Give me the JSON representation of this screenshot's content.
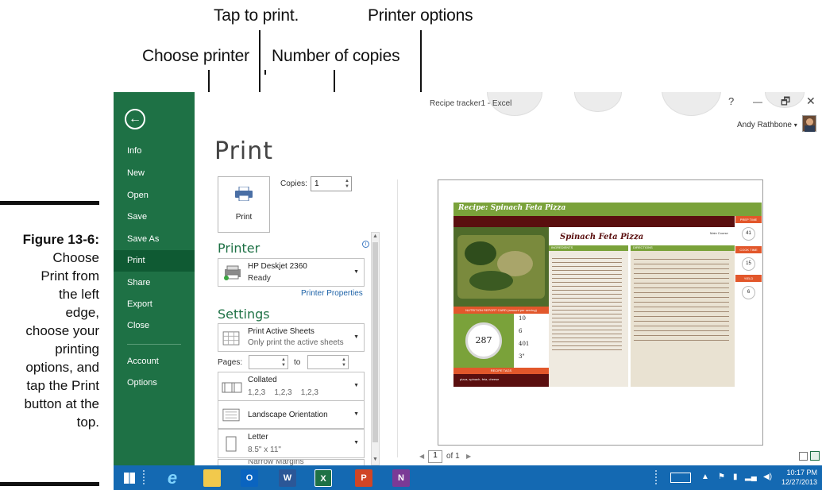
{
  "callouts": {
    "tap_to_print": "Tap to print.",
    "printer_options": "Printer options",
    "choose_printer": "Choose printer",
    "number_of_copies": "Number of copies"
  },
  "caption": {
    "figure": "Figure 13-6:",
    "lines": [
      "Choose",
      "Print from",
      "the left",
      "edge,",
      "choose your",
      "printing",
      "options, and",
      "tap the Print",
      "button at the",
      "top."
    ]
  },
  "app": {
    "window_title": "Recipe tracker1 - Excel",
    "help": "?",
    "minimize": "—",
    "restore": "🗗",
    "close": "✕",
    "user_name": "Andy Rathbone",
    "user_caret": "▾"
  },
  "sidebar": {
    "items": [
      {
        "label": "Info"
      },
      {
        "label": "New"
      },
      {
        "label": "Open"
      },
      {
        "label": "Save"
      },
      {
        "label": "Save As"
      },
      {
        "label": "Print",
        "active": true
      },
      {
        "label": "Share"
      },
      {
        "label": "Export"
      },
      {
        "label": "Close"
      },
      {
        "label": "Account"
      },
      {
        "label": "Options"
      }
    ]
  },
  "print": {
    "title": "Print",
    "print_button_label": "Print",
    "copies_label": "Copies:",
    "copies_value": "1",
    "printer_heading": "Printer",
    "printer_name": "HP Deskjet 2360",
    "printer_status": "Ready",
    "printer_properties": "Printer Properties",
    "settings_heading": "Settings",
    "active_sheets_title": "Print Active Sheets",
    "active_sheets_sub": "Only print the active sheets",
    "pages_label": "Pages:",
    "pages_to": "to",
    "collated_title": "Collated",
    "collated_sub": "1,2,3    1,2,3    1,2,3",
    "orientation": "Landscape Orientation",
    "paper_title": "Letter",
    "paper_sub": "8.5\" x 11\"",
    "margins": "Narrow Margins"
  },
  "preview": {
    "page_number": "1",
    "page_of": "of 1",
    "recipe_header": "Recipe: Spinach Feta Pizza",
    "dish_name": "Spinach Feta Pizza",
    "course": "Main Course",
    "prep_time_label": "PREP TIME",
    "prep_time": "41",
    "cook_time_label": "COOK TIME",
    "cook_time": "15",
    "yield_label": "YIELD",
    "yield": "6",
    "ingredients_label": "INGREDIENTS",
    "directions_label": "DIRECTIONS",
    "nutrition_label": "NUTRITION REPORT CARD (amount per serving)",
    "calories": "287",
    "nut_values": [
      "10",
      "6",
      "401",
      "3\""
    ],
    "recipe_tags_label": "RECIPE TAGS",
    "recipe_tags": "pizza, spinach, feta, cheese"
  },
  "taskbar": {
    "time": "10:17 PM",
    "date": "12/27/2013"
  },
  "colors": {
    "excel_green": "#1e7145",
    "active_green": "#0f5a33",
    "taskbar_blue": "#1469b2",
    "recipe_orange": "#e2572b",
    "recipe_green": "#7aa23a",
    "recipe_maroon": "#5a0f0f"
  }
}
